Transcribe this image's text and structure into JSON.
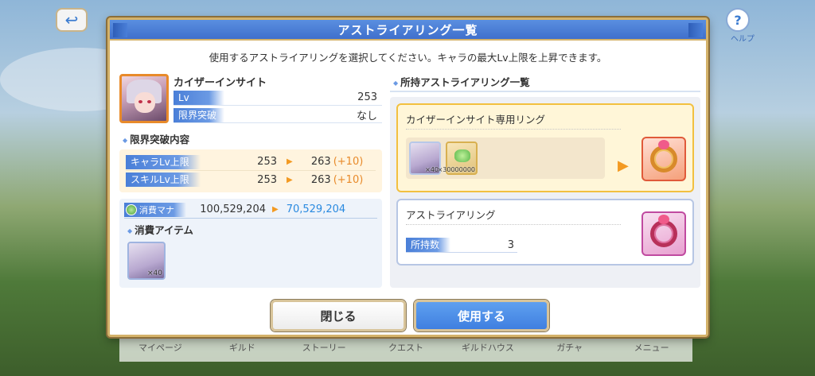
{
  "top": {
    "help_label": "ヘルプ"
  },
  "bottom_nav": [
    "マイページ",
    "ギルド",
    "ストーリー",
    "クエスト",
    "ギルドハウス",
    "ガチャ",
    "メニュー"
  ],
  "dialog": {
    "title": "アストライアリング一覧",
    "instructions": "使用するアストライアリングを選択してください。キャラの最大Lv上限を上昇できます。"
  },
  "character": {
    "name": "カイザーインサイト",
    "lv_label": "Lv",
    "lv_value": "253",
    "limit_break_label": "限界突破",
    "limit_break_value": "なし"
  },
  "limit_section": {
    "title": "限界突破内容",
    "rows": [
      {
        "label": "キャラLv上限",
        "old": "253",
        "new": "263",
        "plus": "(+10)"
      },
      {
        "label": "スキルLv上限",
        "old": "253",
        "new": "263",
        "plus": "(+10)"
      }
    ]
  },
  "cost": {
    "mana_label": "消費マナ",
    "mana_old": "100,529,204",
    "mana_new": "70,529,204",
    "items_title": "消費アイテム",
    "item_count": "×40"
  },
  "rings": {
    "title": "所持アストライアリング一覧",
    "selected": {
      "name": "カイザーインサイト専用リング",
      "materials": [
        {
          "icon": "character-memory-piece-icon",
          "count": "×40"
        },
        {
          "icon": "mana-stone-icon",
          "count": "×30000000"
        }
      ]
    },
    "normal": {
      "name": "アストライアリング",
      "owned_label": "所持数",
      "owned_value": "3"
    }
  },
  "buttons": {
    "close": "閉じる",
    "use": "使用する"
  },
  "colors": {
    "accent": "#4a7fd8",
    "gold_border": "#d4b26a",
    "plus": "#e88a2a",
    "mana_new": "#2a8ae0"
  }
}
